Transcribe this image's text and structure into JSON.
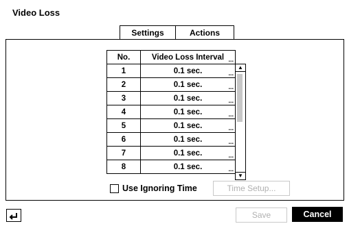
{
  "title": "Video Loss",
  "tabs": [
    {
      "label": "Settings",
      "active": true
    },
    {
      "label": "Actions",
      "active": false
    }
  ],
  "table": {
    "headers": {
      "no": "No.",
      "interval": "Video Loss Interval",
      "header_dots": "..."
    },
    "rows": [
      {
        "no": "1",
        "interval": "0.1 sec.",
        "dots": "..."
      },
      {
        "no": "2",
        "interval": "0.1 sec.",
        "dots": "..."
      },
      {
        "no": "3",
        "interval": "0.1 sec.",
        "dots": "..."
      },
      {
        "no": "4",
        "interval": "0.1 sec.",
        "dots": "..."
      },
      {
        "no": "5",
        "interval": "0.1 sec.",
        "dots": "..."
      },
      {
        "no": "6",
        "interval": "0.1 sec.",
        "dots": "..."
      },
      {
        "no": "7",
        "interval": "0.1 sec.",
        "dots": "..."
      },
      {
        "no": "8",
        "interval": "0.1 sec.",
        "dots": "..."
      }
    ]
  },
  "options": {
    "use_ignoring_time_label": "Use Ignoring Time",
    "use_ignoring_time_checked": false,
    "time_setup_label": "Time Setup..."
  },
  "footer": {
    "save_label": "Save",
    "cancel_label": "Cancel"
  },
  "icons": {
    "back": "back-arrow-icon",
    "scroll_up": "triangle-up-icon",
    "scroll_down": "triangle-down-icon"
  },
  "colors": {
    "disabled_text": "#b0b0b0",
    "primary_button_bg": "#000000",
    "primary_button_text": "#ffffff"
  }
}
